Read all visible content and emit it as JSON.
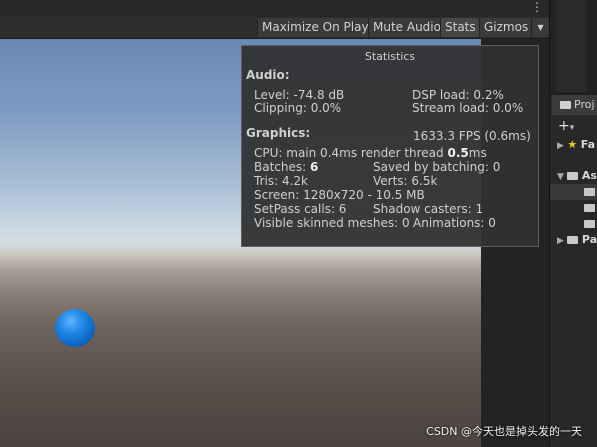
{
  "toolbar": {
    "maximize_on_play": "Maximize On Play",
    "mute_audio": "Mute Audio",
    "stats": "Stats",
    "gizmos": "Gizmos",
    "menu_dots": "⋮",
    "gizmos_arrow": "▾"
  },
  "stats": {
    "title": "Statistics",
    "audio_header": "Audio:",
    "level": "Level: -74.8 dB",
    "dsp_load": "DSP load: 0.2%",
    "clipping": "Clipping: 0.0%",
    "stream_load": "Stream load: 0.0%",
    "graphics_header": "Graphics:",
    "fps": "1633.3 FPS (0.6ms)",
    "cpu_main": "CPU: main 0.4ms",
    "render_thread_label": "render thread",
    "render_thread_value": "0.5",
    "render_thread_unit": "ms",
    "batches_label": "Batches:",
    "batches_value": "6",
    "saved_by_batching": "Saved by batching: 0",
    "tris": "Tris: 4.2k",
    "verts": "Verts: 6.5k",
    "screen": "Screen: 1280x720 - 10.5 MB",
    "setpass": "SetPass calls: 6",
    "shadow_casters": "Shadow casters: 1",
    "visible_skinned": "Visible skinned meshes: 0",
    "animations": "Animations: 0"
  },
  "project_panel": {
    "tab_label": "Proj",
    "add_button": "+",
    "add_arrow": "▾",
    "rows": [
      {
        "label": "Fa"
      },
      {
        "label": "As"
      },
      {
        "label": ""
      },
      {
        "label": ""
      },
      {
        "label": ""
      },
      {
        "label": "Pa"
      }
    ]
  },
  "watermark": "CSDN @今天也是掉头发的一天",
  "colors": {
    "ball": "#1e88e5",
    "star": "#f5c518"
  }
}
